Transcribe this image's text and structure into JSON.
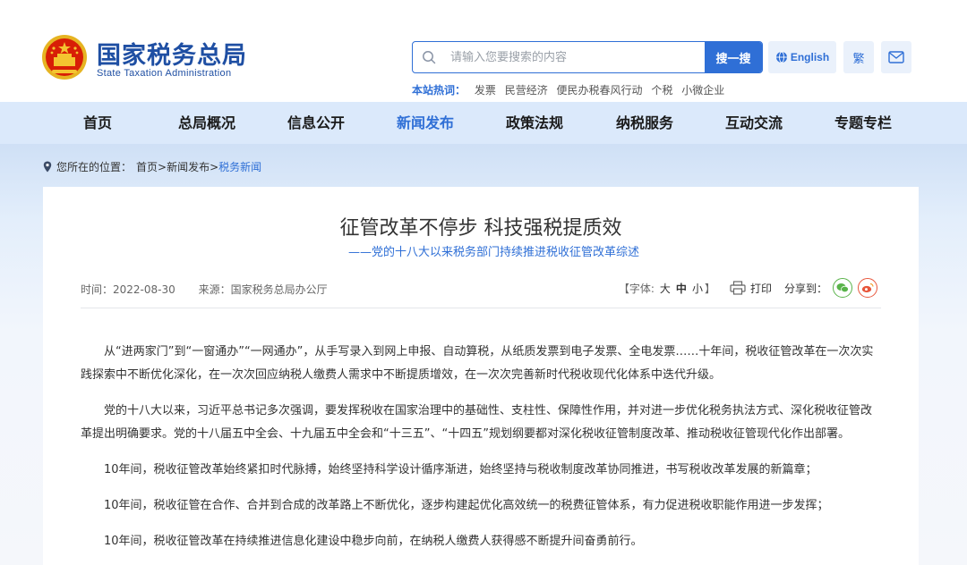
{
  "header": {
    "logo_cn": "国家税务总局",
    "logo_en": "State Taxation Administration",
    "search_placeholder": "请输入您要搜索的内容",
    "search_button": "搜一搜",
    "english_button": "English",
    "traditional_button": "繁",
    "hot_label": "本站热词：",
    "hot_words": [
      "发票",
      "民营经济",
      "便民办税春风行动",
      "个税",
      "小微企业"
    ]
  },
  "nav": {
    "items": [
      "首页",
      "总局概况",
      "信息公开",
      "新闻发布",
      "政策法规",
      "纳税服务",
      "互动交流",
      "专题专栏"
    ],
    "active": "新闻发布"
  },
  "breadcrumb": {
    "prefix": "您所在的位置：",
    "path": "首页>新闻发布>",
    "current": "税务新闻"
  },
  "article": {
    "title": "征管改革不停步 科技强税提质效",
    "subtitle": "——党的十八大以来税务部门持续推进税收征管改革综述",
    "time_label": "时间：2022-08-30",
    "source_label": "来源：国家税务总局办公厅",
    "font_label": "【字体:",
    "font_sizes": [
      "大",
      "中",
      "小"
    ],
    "font_close": "】",
    "print_label": "打印",
    "share_label": "分享到：",
    "paragraphs": [
      "从“进两家门”到“一窗通办”“一网通办”，从手写录入到网上申报、自动算税，从纸质发票到电子发票、全电发票……十年间，税收征管改革在一次次实践探索中不断优化深化，在一次次回应纳税人缴费人需求中不断提质增效，在一次次完善新时代税收现代化体系中迭代升级。",
      "党的十八大以来，习近平总书记多次强调，要发挥税收在国家治理中的基础性、支柱性、保障性作用，并对进一步优化税务执法方式、深化税收征管改革提出明确要求。党的十八届五中全会、十九届五中全会和“十三五”、“十四五”规划纲要都对深化税收征管制度改革、推动税收征管现代化作出部署。",
      "10年间，税收征管改革始终紧扣时代脉搏，始终坚持科学设计循序渐进，始终坚持与税收制度改革协同推进，书写税收改革发展的新篇章；",
      "10年间，税收征管在合作、合并到合成的改革路上不断优化，逐步构建起优化高效统一的税费征管体系，有力促进税收职能作用进一步发挥；",
      "10年间，税收征管改革在持续推进信息化建设中稳步向前，在纳税人缴费人获得感不断提升间奋勇前行。"
    ]
  },
  "colors": {
    "brand_blue": "#2f6fd6",
    "logo_blue": "#1f4fa3",
    "nav_bg": "#dbe9fb"
  }
}
